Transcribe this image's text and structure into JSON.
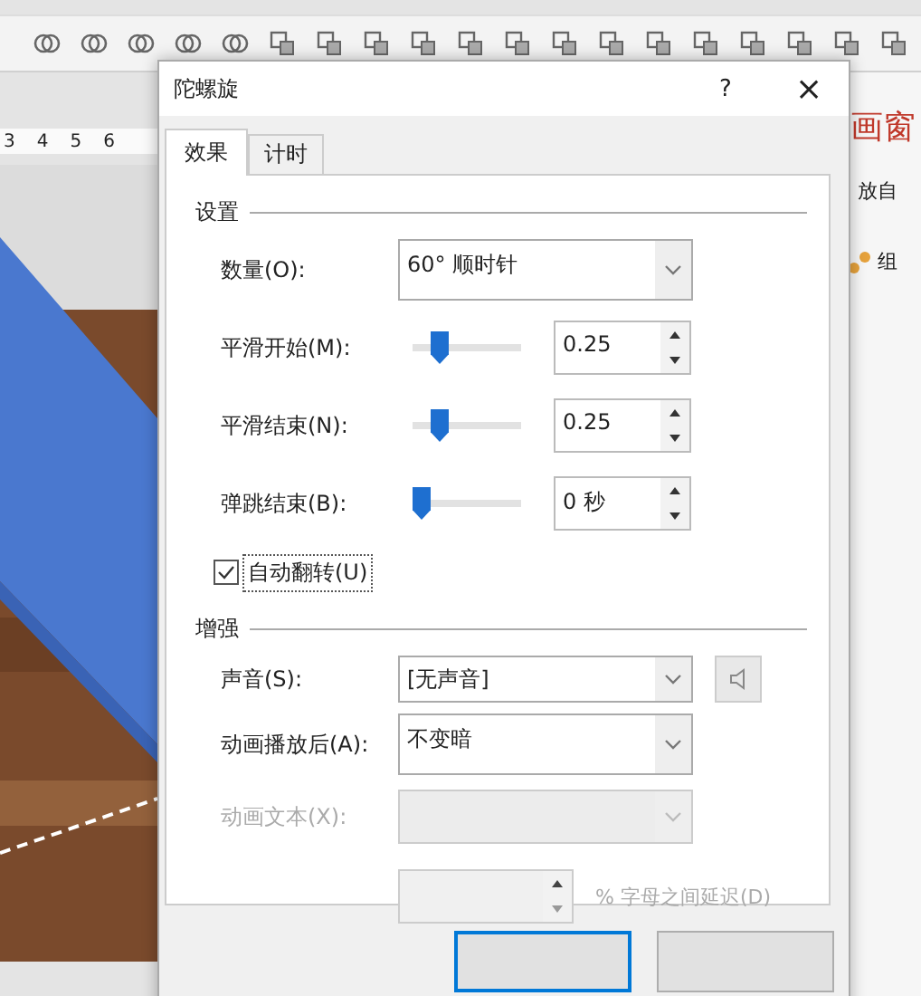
{
  "app": {
    "ruler": [
      "3",
      "4",
      "5",
      "6"
    ],
    "pane_title": "画窗",
    "pane_label": "放自",
    "pane_item": "组"
  },
  "dialog": {
    "title": "陀螺旋",
    "help": "?",
    "close": "×",
    "tabs": [
      {
        "label": "效果",
        "selected": true
      },
      {
        "label": "计时",
        "selected": false
      }
    ],
    "sections": [
      {
        "title": "设置",
        "rows": [
          {
            "kind": "dropdown",
            "label": "数量(O):",
            "value": "60° 顺时针",
            "disabled": false
          },
          {
            "kind": "slider",
            "label": "平滑开始(M):",
            "level": 0.2,
            "value": "0.25"
          },
          {
            "kind": "slider",
            "label": "平滑结束(N):",
            "level": 0.2,
            "value": "0.25"
          },
          {
            "kind": "slider",
            "label": "弹跳结束(B):",
            "level": 0,
            "value": "0 秒"
          },
          {
            "kind": "checkbox",
            "label": "自动翻转(U)",
            "checked": true
          }
        ]
      },
      {
        "title": "增强",
        "rows": [
          {
            "kind": "dropdown",
            "label": "声音(S):",
            "value": "[无声音]",
            "disabled": false,
            "sound_button": true
          },
          {
            "kind": "dropdown",
            "label": "动画播放后(A):",
            "value": "不变暗",
            "disabled": false
          },
          {
            "kind": "dropdown",
            "label": "动画文本(X):",
            "disabled": true
          },
          {
            "kind": "spinner",
            "suffix": "% 字母之间延迟(D)",
            "disabled": true
          }
        ]
      }
    ],
    "buttons": [
      {
        "default": true
      },
      {
        "default": false
      }
    ]
  }
}
